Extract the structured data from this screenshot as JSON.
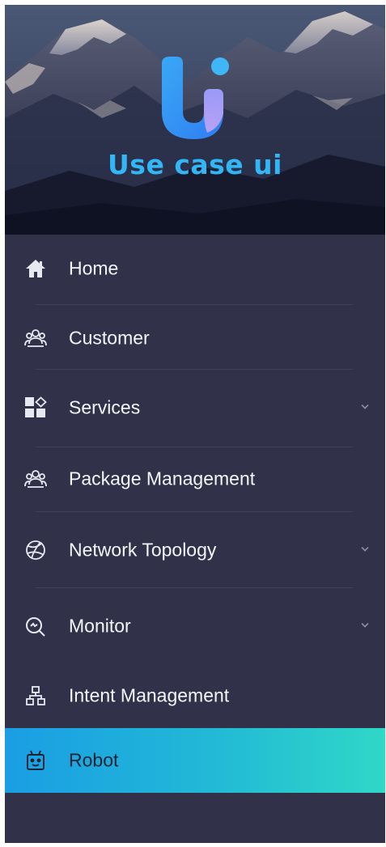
{
  "brand": {
    "name": "Use case ui"
  },
  "menu": {
    "items": [
      {
        "label": "Home",
        "icon": "home-icon",
        "has_submenu": false,
        "active": false
      },
      {
        "label": "Customer",
        "icon": "users-group-icon",
        "has_submenu": false,
        "active": false
      },
      {
        "label": "Services",
        "icon": "apps-grid-icon",
        "has_submenu": true,
        "active": false
      },
      {
        "label": "Package Management",
        "icon": "users-group-icon",
        "has_submenu": false,
        "active": false
      },
      {
        "label": "Network Topology",
        "icon": "globe-icon",
        "has_submenu": true,
        "active": false
      },
      {
        "label": "Monitor",
        "icon": "search-monitor-icon",
        "has_submenu": true,
        "active": false
      },
      {
        "label": "Intent Management",
        "icon": "hierarchy-icon",
        "has_submenu": false,
        "active": false
      },
      {
        "label": "Robot",
        "icon": "robot-icon",
        "has_submenu": false,
        "active": true
      }
    ]
  },
  "colors": {
    "sidebar_bg": "#31324a",
    "text": "#f4f5f9",
    "brand_blue": "#33b6f5",
    "active_gradient_start": "#1a9ee4",
    "active_gradient_end": "#2fd8c7"
  }
}
